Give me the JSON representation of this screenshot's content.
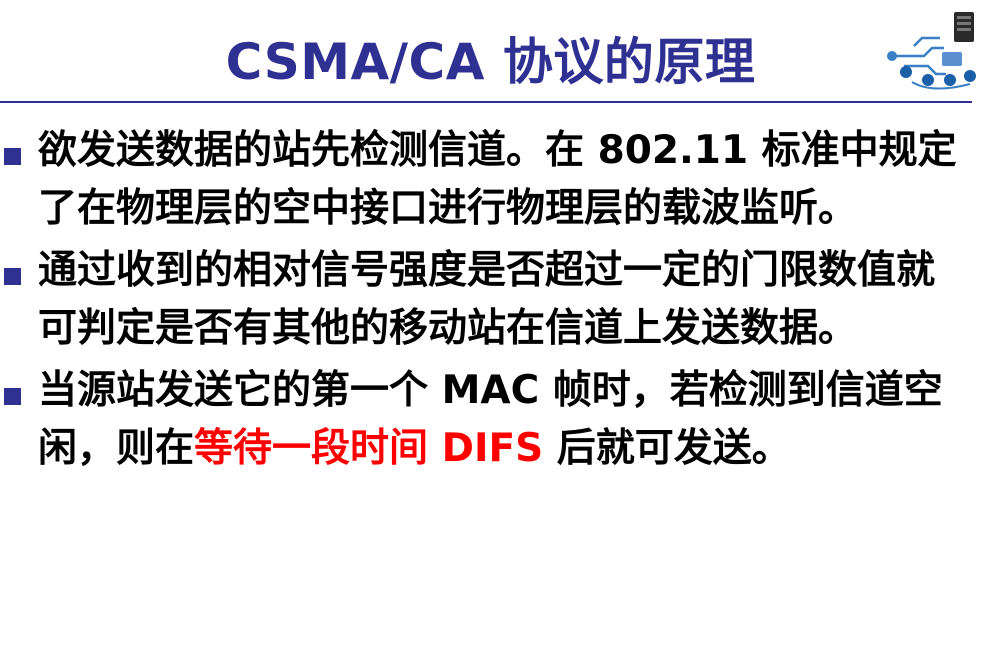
{
  "slide": {
    "title": "CSMA/CA 协议的原理",
    "accent_color": "#2e3192",
    "logo_icon": "network-diagram-icon"
  },
  "bullets": [
    {
      "text": "欲发送数据的站先检测信道。在 802.11 标准中规定了在物理层的空中接口进行物理层的载波监听。"
    },
    {
      "text": "通过收到的相对信号强度是否超过一定的门限数值就可判定是否有其他的移动站在信道上发送数据。"
    },
    {
      "text_before": "当源站发送它的第一个 MAC 帧时，若检测到信道空闲，则在",
      "highlight": "等待一段时间 DIFS",
      "text_after": " 后就可发送。",
      "highlight_color": "#ff0000"
    }
  ]
}
